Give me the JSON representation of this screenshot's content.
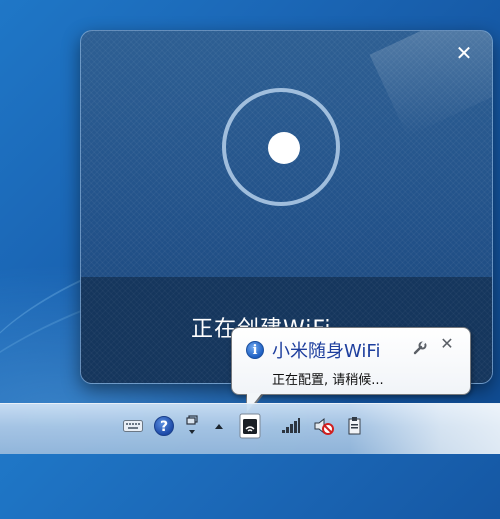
{
  "mi_window": {
    "status_text": "正在创建WiFi",
    "close_symbol": "✕",
    "colors": {
      "panel": "#22528a",
      "band": "#15365d",
      "ring": "#bed7f0",
      "dot": "#ffffff"
    }
  },
  "balloon": {
    "info_glyph": "i",
    "title": "小米随身WiFi",
    "message": "正在配置, 请稍候...",
    "close_symbol": "✕",
    "title_color": "#1e3f9e"
  },
  "taskbar": {
    "tray_icons": [
      "keyboard-icon",
      "help-icon",
      "restore-icon",
      "show-hidden-icons-arrow",
      "mi-wifi-tray-icon",
      "network-signal-icon",
      "volume-muted-icon",
      "action-center-icon"
    ],
    "help_glyph": "?"
  }
}
